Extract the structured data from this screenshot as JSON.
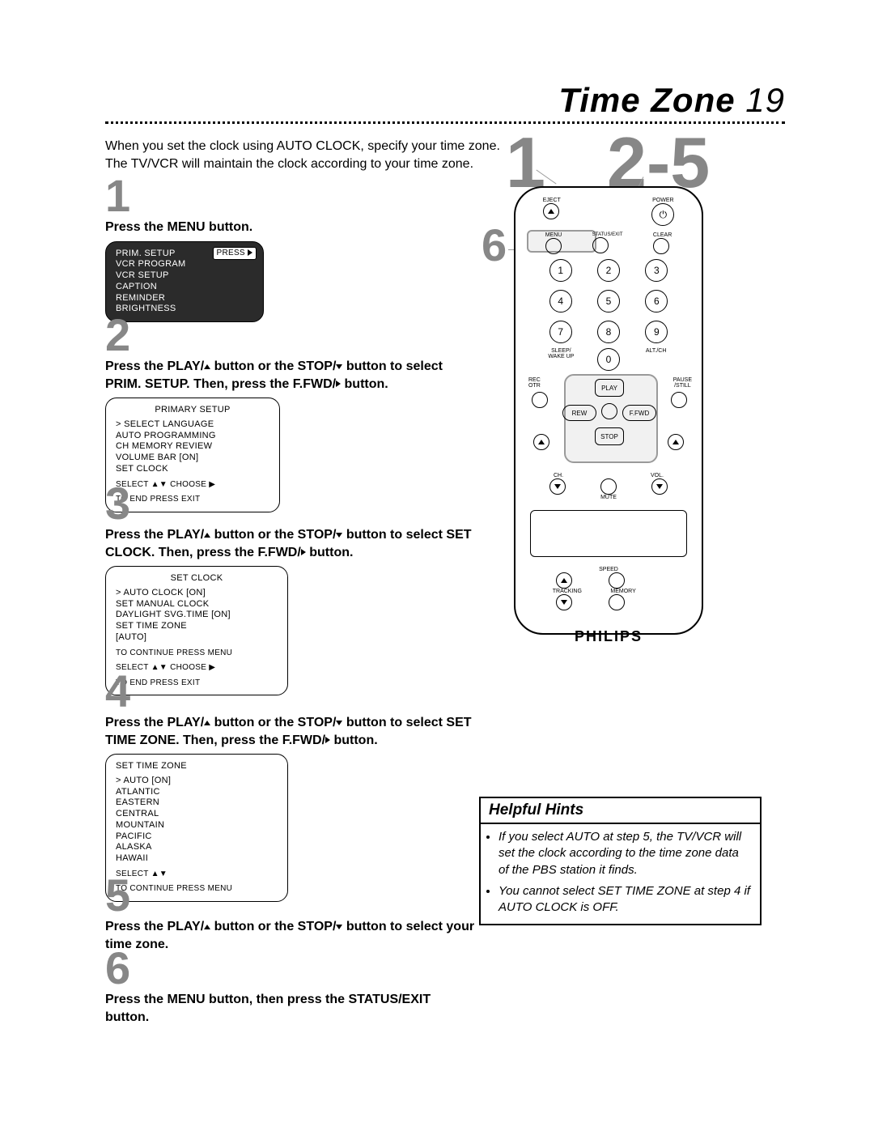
{
  "header": {
    "title": "Time Zone",
    "page_number": "19"
  },
  "intro": "When you set the clock using AUTO CLOCK, specify your time zone. The TV/VCR will maintain the clock according to your time zone.",
  "callouts": {
    "top_left": "1",
    "top_right": "2-5",
    "six": "6"
  },
  "steps": [
    {
      "num": "1",
      "text": "Press the MENU button."
    },
    {
      "num": "2",
      "text_pre": "Press the PLAY/",
      "text_mid1": " button or the STOP/",
      "text_mid2": " button to select PRIM. SETUP.  Then, press the F.FWD/",
      "text_post": " button."
    },
    {
      "num": "3",
      "text_pre": "Press the PLAY/",
      "text_mid1": " button or the STOP/",
      "text_mid2": " button to select SET CLOCK. Then, press the F.FWD/",
      "text_post": " button."
    },
    {
      "num": "4",
      "text_pre": "Press the PLAY/",
      "text_mid1": " button or the STOP/",
      "text_mid2": " button to select SET TIME ZONE. Then, press the F.FWD/",
      "text_post": " button."
    },
    {
      "num": "5",
      "text_pre": "Press the PLAY/",
      "text_mid1": " button or the STOP/",
      "text_mid2": " button to select your time zone.",
      "text_post": ""
    },
    {
      "num": "6",
      "text": "Press the MENU button, then press the STATUS/EXIT button."
    }
  ],
  "screens": {
    "s1": {
      "items": [
        "PRIM. SETUP",
        "VCR PROGRAM",
        "VCR SETUP",
        "CAPTION",
        "REMINDER",
        "BRIGHTNESS"
      ],
      "press": "PRESS"
    },
    "s2": {
      "header": "PRIMARY SETUP",
      "items": [
        "> SELECT LANGUAGE",
        "  AUTO PROGRAMMING",
        "  CH MEMORY REVIEW",
        "  VOLUME BAR            [ON]",
        "  SET CLOCK"
      ],
      "footer1": "SELECT ▲▼ CHOOSE ▶",
      "footer2": "TO  END  PRESS  EXIT"
    },
    "s3": {
      "header": "SET CLOCK",
      "items": [
        "> AUTO CLOCK                  [ON]",
        "  SET MANUAL CLOCK",
        "  DAYLIGHT SVG.TIME        [ON]",
        "  SET TIME ZONE",
        "      [AUTO]"
      ],
      "footer0": "TO CONTINUE PRESS MENU",
      "footer1": "SELECT ▲▼ CHOOSE ▶",
      "footer2": "TO  END  PRESS  EXIT"
    },
    "s4": {
      "header": "SET TIME ZONE",
      "items": [
        "> AUTO                               [ON]",
        "  ATLANTIC",
        "  EASTERN",
        "  CENTRAL",
        "  MOUNTAIN",
        "  PACIFIC",
        "  ALASKA",
        "  HAWAII"
      ],
      "footer1": "SELECT ▲▼",
      "footer2": "TO CONTINUE PRESS MENU"
    }
  },
  "remote": {
    "labels": {
      "eject": "EJECT",
      "power": "POWER",
      "menu": "MENU",
      "status_exit": "STATUS/EXIT",
      "clear": "CLEAR",
      "sleep": "SLEEP/\nWAKE UP",
      "alt": "ALT./CH",
      "rec": "REC\nOTR",
      "pause": "PAUSE\n/STILL",
      "play": "PLAY",
      "rew": "REW",
      "ffwd": "F.FWD",
      "stop": "STOP",
      "ch": "CH.",
      "vol": "VOL.",
      "mute": "MUTE",
      "speed": "SPEED",
      "tracking": "TRACKING",
      "memory": "MEMORY"
    },
    "numbers": [
      "1",
      "2",
      "3",
      "4",
      "5",
      "6",
      "7",
      "8",
      "9",
      "0"
    ],
    "brand": "PHILIPS"
  },
  "hints": {
    "title": "Helpful Hints",
    "items": [
      "If you select AUTO at step 5, the TV/VCR will set the clock according to the time zone data of the PBS station it finds.",
      "You cannot select SET TIME ZONE at step 4 if AUTO CLOCK is OFF."
    ]
  }
}
